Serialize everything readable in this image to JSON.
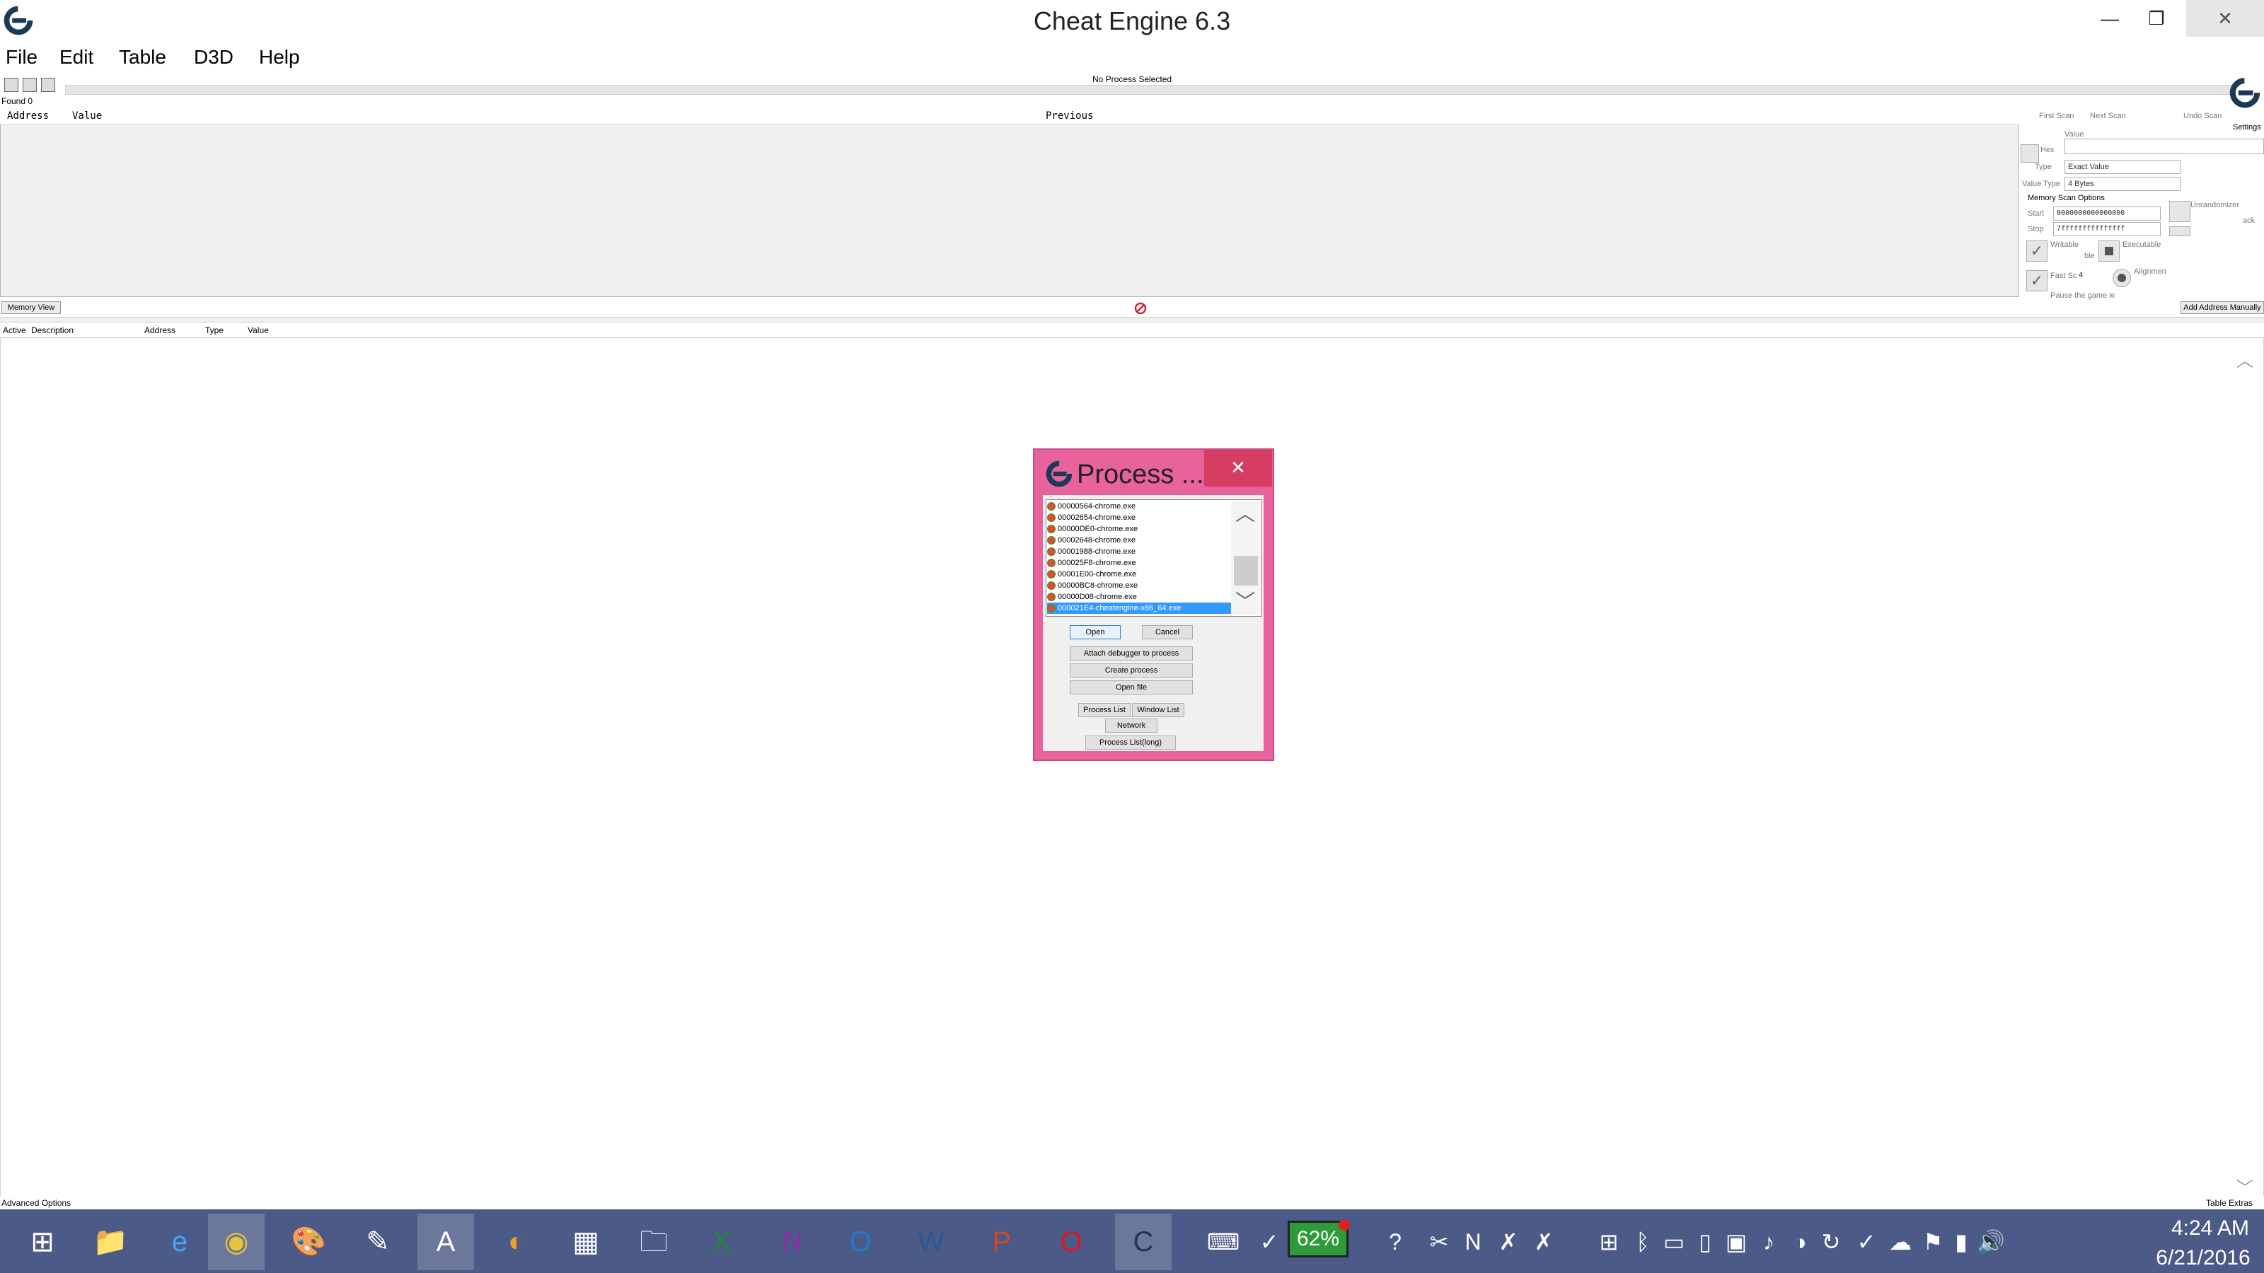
{
  "window": {
    "title": "Cheat Engine 6.3",
    "min": "—",
    "max": "❐",
    "close": "✕"
  },
  "menu": [
    "File",
    "Edit",
    "Table",
    "D3D",
    "Help"
  ],
  "toolbar": {
    "process_label": "No Process Selected"
  },
  "results": {
    "found": "Found 0",
    "columns": [
      "Address",
      "Value",
      "Previous"
    ]
  },
  "scan_panel": {
    "first_scan": "First Scan",
    "next_scan": "Next Scan",
    "undo_scan": "Undo Scan",
    "settings": "Settings",
    "value_label": "Value",
    "hex_label": "Hex",
    "scan_type_label": "Type",
    "scan_type_value": "Exact Value",
    "value_type_label": "Value Type",
    "value_type_value": "4 Bytes",
    "memory_scan_options": "Memory Scan Options",
    "start_label": "Start",
    "start_value": "0000000000000000",
    "stop_label": "Stop",
    "stop_value": "7fffffffffffffff",
    "writable": "Writable",
    "executable": "Executable",
    "copy_on_write": "ble",
    "fast_scan": "Fast Sc",
    "fast_scan_value": "4",
    "alignment": "Alignmen",
    "unrandomizer": "Unrandomizer",
    "speedhack": "ack",
    "pause": "Pause the game w"
  },
  "buttons": {
    "memory_view": "Memory View",
    "add_address": "Add Address Manually"
  },
  "address_list": {
    "columns": [
      "Active",
      "Description",
      "Address",
      "Type",
      "Value"
    ]
  },
  "footer": {
    "advanced": "Advanced Options",
    "table_extras": "Table Extras"
  },
  "dialog": {
    "title": "Process ...",
    "close": "✕",
    "processes": [
      "00000564-chrome.exe",
      "00002654-chrome.exe",
      "00000DE0-chrome.exe",
      "00002648-chrome.exe",
      "00001988-chrome.exe",
      "000025F8-chrome.exe",
      "00001E00-chrome.exe",
      "00000BC8-chrome.exe",
      "00000D08-chrome.exe",
      "000021E4-cheatengine-x86_64.exe"
    ],
    "open": "Open",
    "cancel": "Cancel",
    "attach": "Attach debugger to process",
    "create": "Create process",
    "open_file": "Open file",
    "process_list": "Process List",
    "window_list": "Window List",
    "network": "Network",
    "process_list_long": "Process List(long)"
  },
  "taskbar": {
    "battery": "62%",
    "time": "4:24 AM",
    "date": "6/21/2016",
    "apps": [
      "windows-start",
      "file-explorer-folder",
      "internet-explorer",
      "chrome",
      "paint",
      "notepad",
      "wordpad",
      "firefox",
      "calculator",
      "file-explorer",
      "excel",
      "onenote",
      "outlook",
      "word",
      "powerpoint",
      "opera",
      "cheat-engine"
    ],
    "tray_icons": [
      "keyboard",
      "shield",
      "battery",
      "help",
      "tool",
      "onenote-small",
      "pdf",
      "network-x",
      "windows",
      "bluetooth",
      "display",
      "device",
      "monitor",
      "volume",
      "color",
      "refresh",
      "check",
      "cloud",
      "flag",
      "signal",
      "speaker"
    ]
  }
}
